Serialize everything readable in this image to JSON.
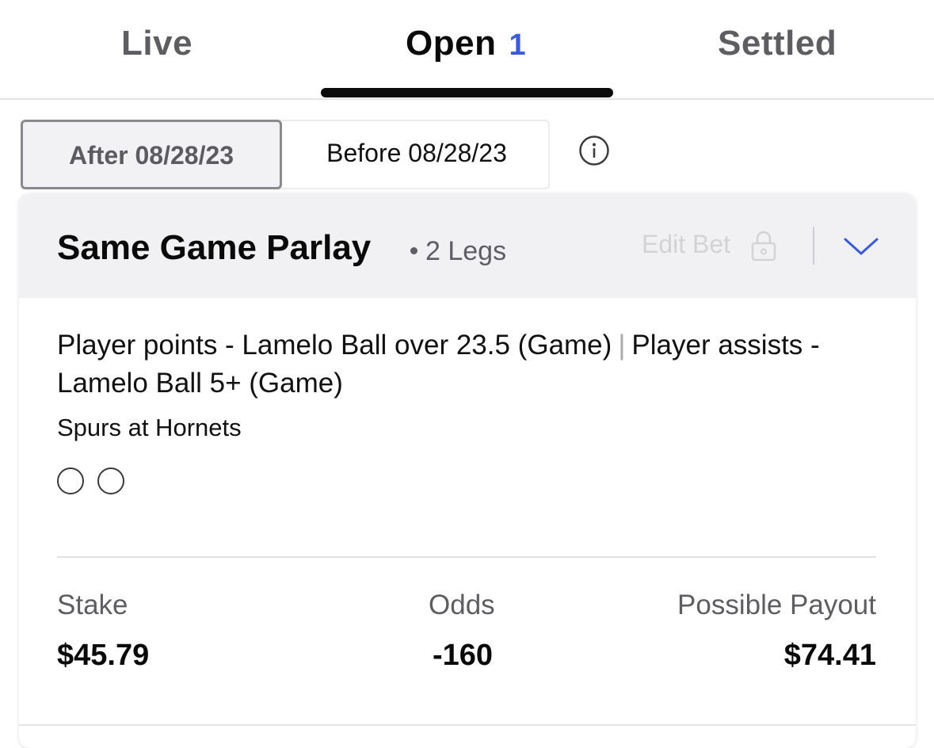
{
  "tabs": {
    "live": "Live",
    "open": "Open",
    "open_count": "1",
    "settled": "Settled",
    "active": "Open"
  },
  "date_filter": {
    "after": "After 08/28/23",
    "before": "Before 08/28/23",
    "selected": "After 08/28/23"
  },
  "bet": {
    "type": "Same Game Parlay",
    "legs_text": "2 Legs",
    "edit_label": "Edit Bet",
    "leg_1": "Player points - Lamelo Ball over 23.5 (Game)",
    "leg_separator": "|",
    "leg_2": "Player assists - Lamelo Ball 5+ (Game)",
    "matchup": "Spurs at Hornets",
    "stake_label": "Stake",
    "stake_value": "$45.79",
    "odds_label": "Odds",
    "odds_value": "-160",
    "payout_label": "Possible Payout",
    "payout_value": "$74.41"
  },
  "colors": {
    "accent": "#3b5bdb",
    "header_bg": "#f1f1f3",
    "muted_text": "#5e5e62",
    "disabled_text": "#d3d3d6"
  },
  "icons": {
    "info": "info-icon",
    "lock": "lock-icon",
    "chevron": "chevron-down-icon",
    "leg_status": "empty-circle-icon"
  }
}
